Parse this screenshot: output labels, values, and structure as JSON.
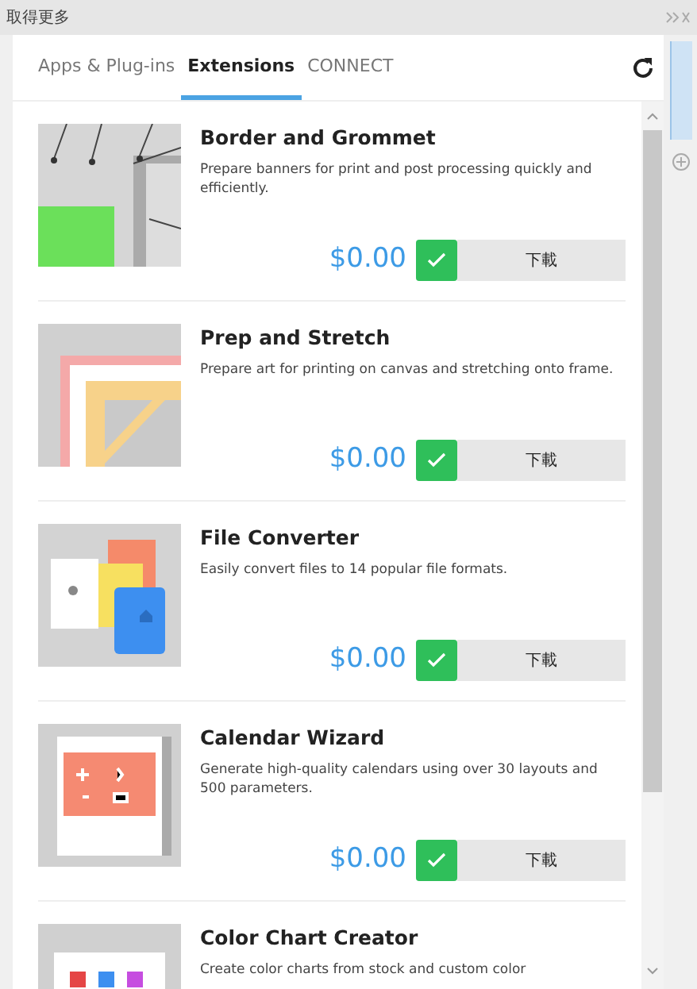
{
  "panel": {
    "title": "取得更多"
  },
  "tabs": [
    {
      "label": "Apps & Plug-ins",
      "selected": false
    },
    {
      "label": "Extensions",
      "selected": true
    },
    {
      "label": "CONNECT",
      "selected": false
    }
  ],
  "items": [
    {
      "title": "Border and Grommet",
      "description": "Prepare banners for print and post processing quickly and efficiently.",
      "price": "$0.00",
      "button": "下載",
      "checked": true
    },
    {
      "title": "Prep and Stretch",
      "description": "Prepare art for printing on canvas and stretching onto frame.",
      "price": "$0.00",
      "button": "下載",
      "checked": true
    },
    {
      "title": "File Converter",
      "description": "Easily convert files to 14 popular file formats.",
      "price": "$0.00",
      "button": "下載",
      "checked": true
    },
    {
      "title": "Calendar Wizard",
      "description": "Generate high-quality calendars using over 30 layouts and 500 parameters.",
      "price": "$0.00",
      "button": "下載",
      "checked": true
    },
    {
      "title": "Color Chart Creator",
      "description": "Create color charts from stock and custom color"
    }
  ]
}
